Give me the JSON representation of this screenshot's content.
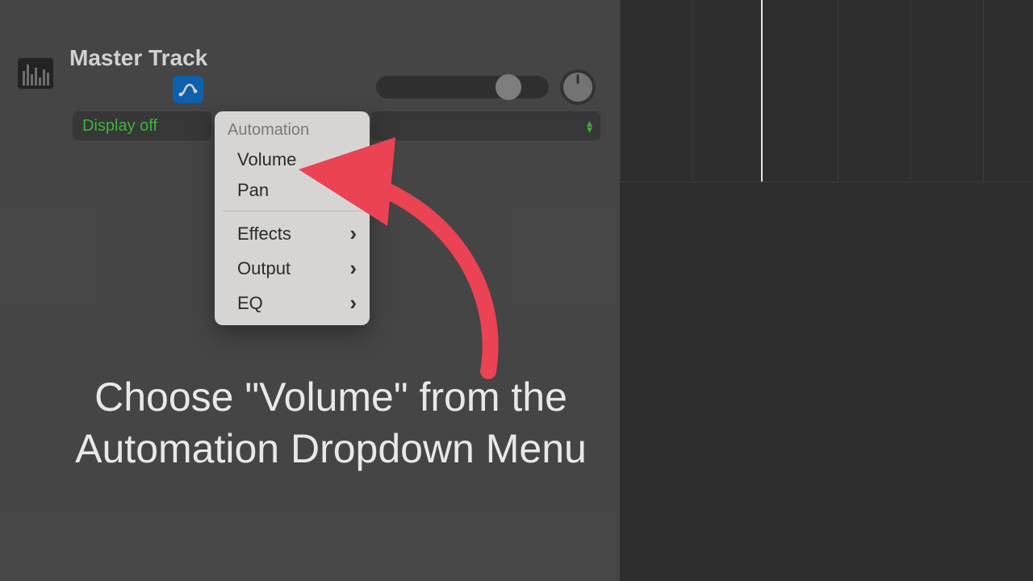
{
  "track": {
    "title": "Master Track",
    "display_mode": "Display off"
  },
  "automation_menu": {
    "header": "Automation",
    "items_primary": [
      "Volume",
      "Pan"
    ],
    "items_sub": [
      "Effects",
      "Output",
      "EQ"
    ]
  },
  "caption": "Choose \"Volume\" from the Automation Dropdown Menu",
  "colors": {
    "accent_blue": "#1176d1",
    "accent_green": "#4bd94b",
    "arrow": "#eb4254"
  }
}
